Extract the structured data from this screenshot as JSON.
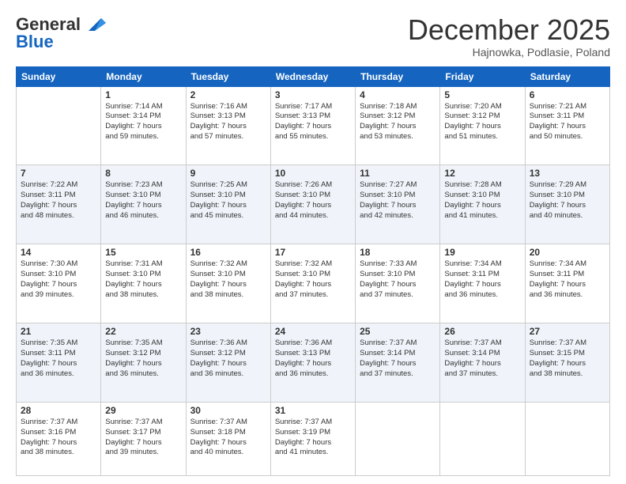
{
  "header": {
    "logo_general": "General",
    "logo_blue": "Blue",
    "month_title": "December 2025",
    "subtitle": "Hajnowka, Podlasie, Poland"
  },
  "days_of_week": [
    "Sunday",
    "Monday",
    "Tuesday",
    "Wednesday",
    "Thursday",
    "Friday",
    "Saturday"
  ],
  "weeks": [
    [
      {
        "day": "",
        "info": ""
      },
      {
        "day": "1",
        "info": "Sunrise: 7:14 AM\nSunset: 3:14 PM\nDaylight: 7 hours\nand 59 minutes."
      },
      {
        "day": "2",
        "info": "Sunrise: 7:16 AM\nSunset: 3:13 PM\nDaylight: 7 hours\nand 57 minutes."
      },
      {
        "day": "3",
        "info": "Sunrise: 7:17 AM\nSunset: 3:13 PM\nDaylight: 7 hours\nand 55 minutes."
      },
      {
        "day": "4",
        "info": "Sunrise: 7:18 AM\nSunset: 3:12 PM\nDaylight: 7 hours\nand 53 minutes."
      },
      {
        "day": "5",
        "info": "Sunrise: 7:20 AM\nSunset: 3:12 PM\nDaylight: 7 hours\nand 51 minutes."
      },
      {
        "day": "6",
        "info": "Sunrise: 7:21 AM\nSunset: 3:11 PM\nDaylight: 7 hours\nand 50 minutes."
      }
    ],
    [
      {
        "day": "7",
        "info": "Sunrise: 7:22 AM\nSunset: 3:11 PM\nDaylight: 7 hours\nand 48 minutes."
      },
      {
        "day": "8",
        "info": "Sunrise: 7:23 AM\nSunset: 3:10 PM\nDaylight: 7 hours\nand 46 minutes."
      },
      {
        "day": "9",
        "info": "Sunrise: 7:25 AM\nSunset: 3:10 PM\nDaylight: 7 hours\nand 45 minutes."
      },
      {
        "day": "10",
        "info": "Sunrise: 7:26 AM\nSunset: 3:10 PM\nDaylight: 7 hours\nand 44 minutes."
      },
      {
        "day": "11",
        "info": "Sunrise: 7:27 AM\nSunset: 3:10 PM\nDaylight: 7 hours\nand 42 minutes."
      },
      {
        "day": "12",
        "info": "Sunrise: 7:28 AM\nSunset: 3:10 PM\nDaylight: 7 hours\nand 41 minutes."
      },
      {
        "day": "13",
        "info": "Sunrise: 7:29 AM\nSunset: 3:10 PM\nDaylight: 7 hours\nand 40 minutes."
      }
    ],
    [
      {
        "day": "14",
        "info": "Sunrise: 7:30 AM\nSunset: 3:10 PM\nDaylight: 7 hours\nand 39 minutes."
      },
      {
        "day": "15",
        "info": "Sunrise: 7:31 AM\nSunset: 3:10 PM\nDaylight: 7 hours\nand 38 minutes."
      },
      {
        "day": "16",
        "info": "Sunrise: 7:32 AM\nSunset: 3:10 PM\nDaylight: 7 hours\nand 38 minutes."
      },
      {
        "day": "17",
        "info": "Sunrise: 7:32 AM\nSunset: 3:10 PM\nDaylight: 7 hours\nand 37 minutes."
      },
      {
        "day": "18",
        "info": "Sunrise: 7:33 AM\nSunset: 3:10 PM\nDaylight: 7 hours\nand 37 minutes."
      },
      {
        "day": "19",
        "info": "Sunrise: 7:34 AM\nSunset: 3:11 PM\nDaylight: 7 hours\nand 36 minutes."
      },
      {
        "day": "20",
        "info": "Sunrise: 7:34 AM\nSunset: 3:11 PM\nDaylight: 7 hours\nand 36 minutes."
      }
    ],
    [
      {
        "day": "21",
        "info": "Sunrise: 7:35 AM\nSunset: 3:11 PM\nDaylight: 7 hours\nand 36 minutes."
      },
      {
        "day": "22",
        "info": "Sunrise: 7:35 AM\nSunset: 3:12 PM\nDaylight: 7 hours\nand 36 minutes."
      },
      {
        "day": "23",
        "info": "Sunrise: 7:36 AM\nSunset: 3:12 PM\nDaylight: 7 hours\nand 36 minutes."
      },
      {
        "day": "24",
        "info": "Sunrise: 7:36 AM\nSunset: 3:13 PM\nDaylight: 7 hours\nand 36 minutes."
      },
      {
        "day": "25",
        "info": "Sunrise: 7:37 AM\nSunset: 3:14 PM\nDaylight: 7 hours\nand 37 minutes."
      },
      {
        "day": "26",
        "info": "Sunrise: 7:37 AM\nSunset: 3:14 PM\nDaylight: 7 hours\nand 37 minutes."
      },
      {
        "day": "27",
        "info": "Sunrise: 7:37 AM\nSunset: 3:15 PM\nDaylight: 7 hours\nand 38 minutes."
      }
    ],
    [
      {
        "day": "28",
        "info": "Sunrise: 7:37 AM\nSunset: 3:16 PM\nDaylight: 7 hours\nand 38 minutes."
      },
      {
        "day": "29",
        "info": "Sunrise: 7:37 AM\nSunset: 3:17 PM\nDaylight: 7 hours\nand 39 minutes."
      },
      {
        "day": "30",
        "info": "Sunrise: 7:37 AM\nSunset: 3:18 PM\nDaylight: 7 hours\nand 40 minutes."
      },
      {
        "day": "31",
        "info": "Sunrise: 7:37 AM\nSunset: 3:19 PM\nDaylight: 7 hours\nand 41 minutes."
      },
      {
        "day": "",
        "info": ""
      },
      {
        "day": "",
        "info": ""
      },
      {
        "day": "",
        "info": ""
      }
    ]
  ]
}
